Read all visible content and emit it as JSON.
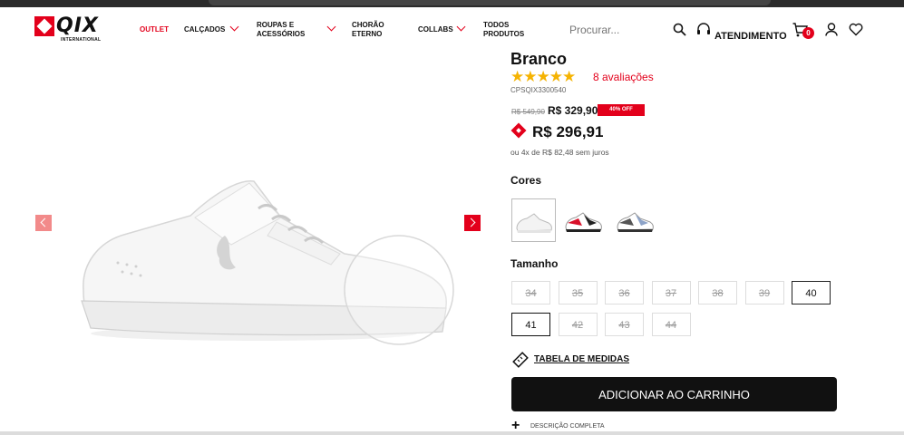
{
  "brand": {
    "name": "QIX",
    "subtitle": "INTERNATIONAL"
  },
  "nav": {
    "outlet": "OUTLET",
    "calcados": "CALÇADOS",
    "roupas": "ROUPAS E ACESSÓRIOS",
    "chorao": "CHORÃO ETERNO",
    "collabs": "COLLABS",
    "todos": "TODOS PRODUTOS"
  },
  "search": {
    "placeholder": "Procurar..."
  },
  "header": {
    "atendimento": "ATENDIMENTO",
    "cart_count": "0"
  },
  "product": {
    "title": "Branco",
    "rating_stars": "★★★★★",
    "reviews": "8 avaliações",
    "sku": "CPSQIX3300540",
    "old_price": "R$ 549,90",
    "price": "R$ 329,90",
    "discount": "40% OFF",
    "pix_price": "R$ 296,91",
    "installments": "ou 4x de R$ 82,48 sem juros"
  },
  "colors": {
    "label": "Cores",
    "options": [
      "white",
      "red-black",
      "grey-black"
    ]
  },
  "sizes": {
    "label": "Tamanho",
    "items": [
      {
        "value": "34",
        "available": false
      },
      {
        "value": "35",
        "available": false
      },
      {
        "value": "36",
        "available": false
      },
      {
        "value": "37",
        "available": false
      },
      {
        "value": "38",
        "available": false
      },
      {
        "value": "39",
        "available": false
      },
      {
        "value": "40",
        "available": true
      },
      {
        "value": "41",
        "available": true,
        "selected": true
      },
      {
        "value": "42",
        "available": false
      },
      {
        "value": "43",
        "available": false
      },
      {
        "value": "44",
        "available": false
      }
    ]
  },
  "actions": {
    "size_table": "TABELA DE MEDIDAS",
    "add_to_cart": "ADICIONAR AO CARRINHO",
    "description": "DESCRIÇÃO COMPLETA"
  },
  "colors_theme": {
    "accent": "#e3001b",
    "button": "#111111"
  }
}
